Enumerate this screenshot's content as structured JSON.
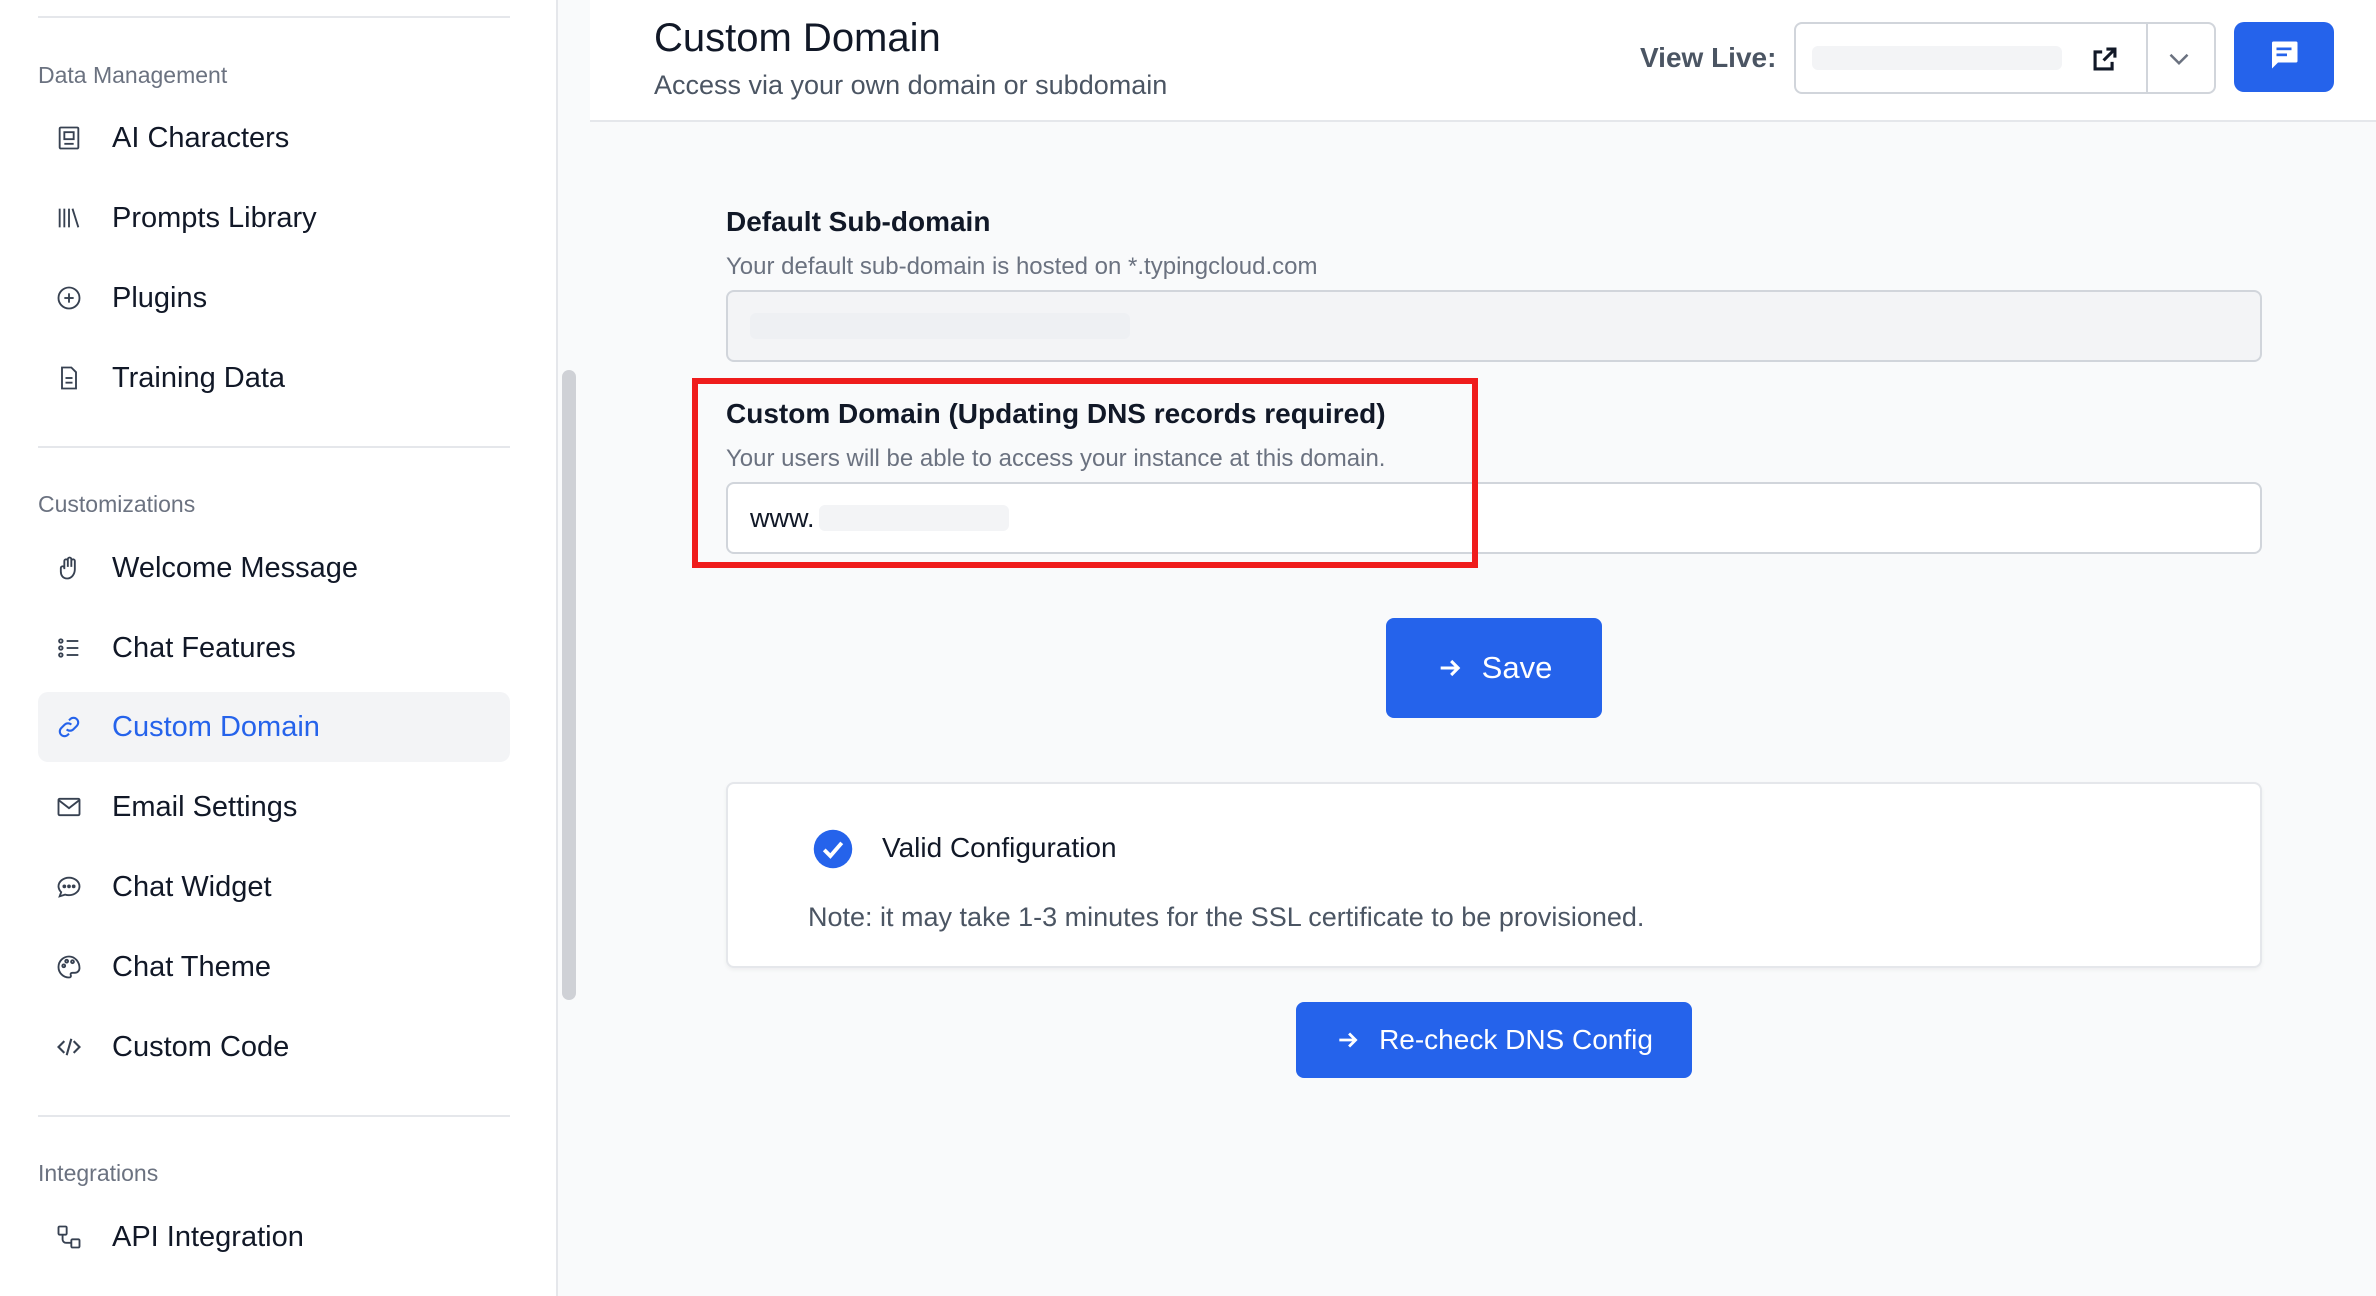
{
  "sidebar": {
    "sections": [
      {
        "title": "Data Management",
        "items": [
          {
            "label": "AI Characters",
            "icon": "ai-character-icon"
          },
          {
            "label": "Prompts Library",
            "icon": "library-icon"
          },
          {
            "label": "Plugins",
            "icon": "plus-circle-icon"
          },
          {
            "label": "Training Data",
            "icon": "document-icon"
          }
        ]
      },
      {
        "title": "Customizations",
        "items": [
          {
            "label": "Welcome Message",
            "icon": "hand-icon"
          },
          {
            "label": "Chat Features",
            "icon": "list-icon"
          },
          {
            "label": "Custom Domain",
            "icon": "link-icon",
            "active": true
          },
          {
            "label": "Email Settings",
            "icon": "envelope-icon"
          },
          {
            "label": "Chat Widget",
            "icon": "chat-bubble-icon"
          },
          {
            "label": "Chat Theme",
            "icon": "palette-icon"
          },
          {
            "label": "Custom Code",
            "icon": "code-icon"
          }
        ]
      },
      {
        "title": "Integrations",
        "items": [
          {
            "label": "API Integration",
            "icon": "api-icon"
          }
        ]
      }
    ]
  },
  "header": {
    "title": "Custom Domain",
    "subtitle": "Access via your own domain or subdomain",
    "view_live_label": "View Live:"
  },
  "default_subdomain": {
    "label": "Default Sub-domain",
    "help": "Your default sub-domain is hosted on *.typingcloud.com"
  },
  "custom_domain": {
    "label": "Custom Domain (Updating DNS records required)",
    "help": "Your users will be able to access your instance at this domain.",
    "value_prefix": "www."
  },
  "save_label": "Save",
  "status": {
    "title": "Valid Configuration",
    "note": "Note: it may take 1-3 minutes for the SSL certificate to be provisioned."
  },
  "recheck_label": "Re-check DNS Config",
  "colors": {
    "accent": "#2563eb",
    "highlight": "#ef1c1c",
    "active_bg": "#f3f4f6"
  }
}
